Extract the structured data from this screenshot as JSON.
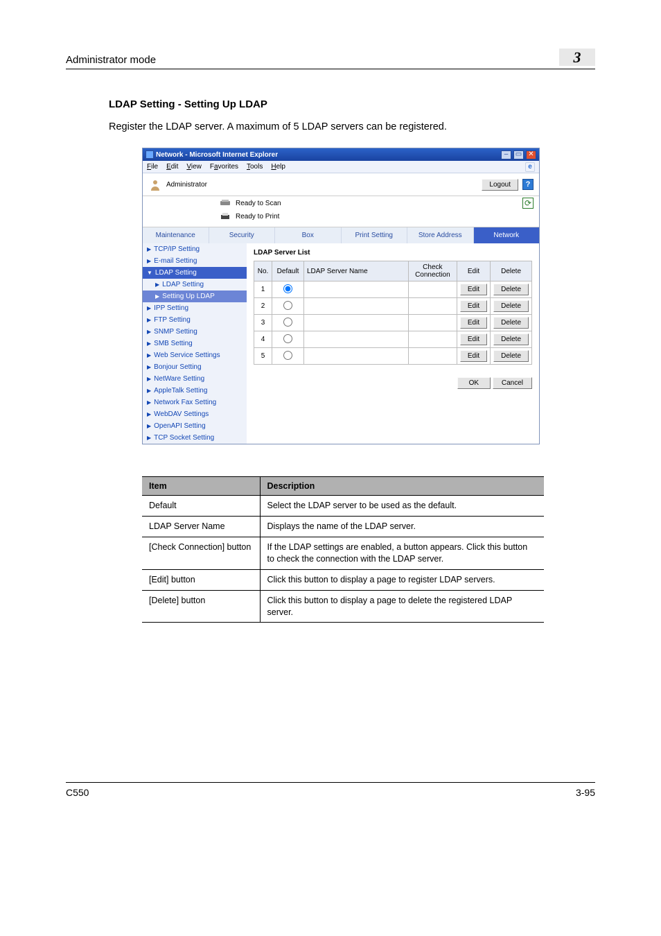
{
  "header": {
    "breadcrumb": "Administrator mode",
    "chapter": "3"
  },
  "section": {
    "title": "LDAP Setting - Setting Up LDAP",
    "intro": "Register the LDAP server. A maximum of 5 LDAP servers can be registered."
  },
  "shot": {
    "titlebar": "Network - Microsoft Internet Explorer",
    "menus": {
      "file": "File",
      "edit": "Edit",
      "view": "View",
      "fav": "Favorites",
      "tools": "Tools",
      "help": "Help"
    },
    "admin_label": "Administrator",
    "logout_label": "Logout",
    "ready_scan": "Ready to Scan",
    "ready_print": "Ready to Print",
    "tabs": [
      "Maintenance",
      "Security",
      "Box",
      "Print Setting",
      "Store Address",
      "Network"
    ],
    "side": [
      "TCP/IP Setting",
      "E-mail Setting",
      "LDAP Setting",
      "LDAP Setting",
      "Setting Up LDAP",
      "IPP Setting",
      "FTP Setting",
      "SNMP Setting",
      "SMB Setting",
      "Web Service Settings",
      "Bonjour Setting",
      "NetWare Setting",
      "AppleTalk Setting",
      "Network Fax Setting",
      "WebDAV Settings",
      "OpenAPI Setting",
      "TCP Socket Setting"
    ],
    "panel_title": "LDAP Server List",
    "cols": {
      "no": "No.",
      "def": "Default",
      "name": "LDAP Server Name",
      "check": "Check Connection",
      "edit": "Edit",
      "del": "Delete"
    },
    "rows": [
      {
        "no": "1",
        "def": true,
        "name": "",
        "check": ""
      },
      {
        "no": "2",
        "def": false,
        "name": "",
        "check": ""
      },
      {
        "no": "3",
        "def": false,
        "name": "",
        "check": ""
      },
      {
        "no": "4",
        "def": false,
        "name": "",
        "check": ""
      },
      {
        "no": "5",
        "def": false,
        "name": "",
        "check": ""
      }
    ],
    "btn_edit": "Edit",
    "btn_delete": "Delete",
    "btn_ok": "OK",
    "btn_cancel": "Cancel"
  },
  "desc": {
    "head_item": "Item",
    "head_desc": "Description",
    "rows": [
      {
        "item": "Default",
        "desc": "Select the LDAP server to be used as the default."
      },
      {
        "item": "LDAP Server Name",
        "desc": "Displays the name of the LDAP server."
      },
      {
        "item": "[Check Connection] button",
        "desc": "If the LDAP settings are enabled, a button appears. Click this button to check the connection with the LDAP server."
      },
      {
        "item": "[Edit] button",
        "desc": "Click this button to display a page to register LDAP servers."
      },
      {
        "item": "[Delete] button",
        "desc": "Click this button to display a page to delete the registered LDAP server."
      }
    ]
  },
  "footer": {
    "left": "C550",
    "right": "3-95"
  }
}
